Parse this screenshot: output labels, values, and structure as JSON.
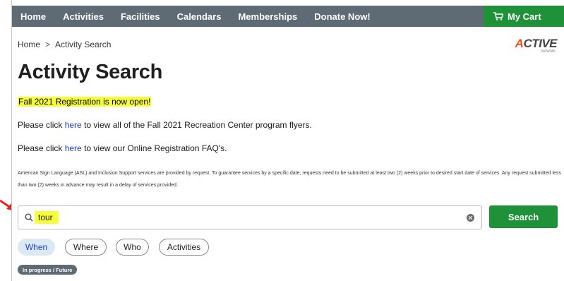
{
  "nav": {
    "items": [
      "Home",
      "Activities",
      "Facilities",
      "Calendars",
      "Memberships",
      "Donate Now!"
    ],
    "cart_label": "My Cart"
  },
  "breadcrumb": {
    "home": "Home",
    "separator": ">",
    "current": "Activity Search"
  },
  "logo": {
    "word_accent": "A",
    "word_rest": "CTIVE",
    "sub": "network"
  },
  "page_title": "Activity Search",
  "announcement": "Fall 2021 Registration is now open!",
  "paragraphs": {
    "p1_before": "Please click ",
    "p1_link": "here",
    "p1_after": " to view all of the Fall 2021 Recreation Center program flyers.",
    "p2_before": "Please click ",
    "p2_link": "here",
    "p2_after": " to view our Online Registration FAQ's."
  },
  "notice": "American Sign Language (ASL) and Inclusion Support services are provided by request. To guarantee services by a specific date, requests need to be submitted at least two (2) weeks prior to desired start date of services. Any request submitted less than two (2) weeks in advance may result in a delay of services provided.",
  "search": {
    "value": "tour",
    "button_label": "Search"
  },
  "filters": {
    "when": "When",
    "where": "Where",
    "who": "Who",
    "activities": "Activities"
  },
  "status_chip": "In progress / Future",
  "colors": {
    "nav_bg": "#5e6b75",
    "brand_green": "#1f9138",
    "highlight": "#f5ff3a",
    "link": "#1d3ec7",
    "arrow": "#e8241a"
  },
  "icons": {
    "cart": "cart-icon",
    "search": "search-icon",
    "clear": "clear-icon",
    "annotation": "red-arrow-icon"
  }
}
